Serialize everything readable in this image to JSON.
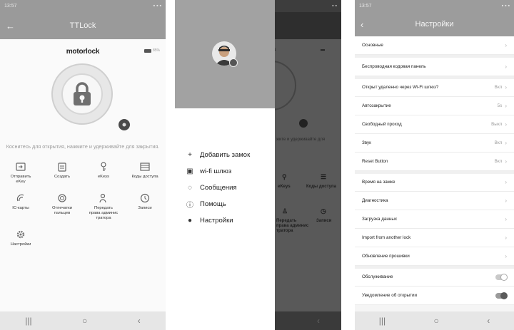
{
  "panel_lock": {
    "status_time": "13:57",
    "status_right": "▪ ▪ ▪",
    "title": "TTLock",
    "brand": "motorlock",
    "battery": "85%",
    "hint": "Коснитесь для открытия, нажмите и удерживайте для закрытия.",
    "grid": [
      {
        "label": "Отправить\neKey",
        "icon": "send-ekey-icon"
      },
      {
        "label": "Создать",
        "icon": "create-icon"
      },
      {
        "label": "eKeys",
        "icon": "ekeys-icon"
      },
      {
        "label": "Коды доступа",
        "icon": "access-codes-icon"
      },
      {
        "label": "IC-карты",
        "icon": "ic-card-icon"
      },
      {
        "label": "Отпечатки\nпальцев",
        "icon": "fingerprint-icon"
      },
      {
        "label": "Передать\nправа админис\nтратора",
        "icon": "transfer-admin-icon"
      },
      {
        "label": "Записи",
        "icon": "records-icon"
      },
      {
        "label": "Настройки",
        "icon": "settings-icon"
      }
    ],
    "nav": [
      "|||",
      "○",
      "‹"
    ]
  },
  "panel_menu": {
    "items": [
      {
        "label": "Добавить замок",
        "icon": "plus-icon"
      },
      {
        "label": "wi-fi шлюз",
        "icon": "gateway-icon"
      },
      {
        "label": "Сообщения",
        "icon": "message-icon"
      },
      {
        "label": "Помощь",
        "icon": "help-icon"
      },
      {
        "label": "Настройки",
        "icon": "settings-icon"
      }
    ],
    "nav": [
      "‹"
    ]
  },
  "panel_settings": {
    "status_time": "13:57",
    "status_right": "▪ ▪ ▪",
    "title": "Настройки",
    "groups": [
      [
        {
          "label": "Основные",
          "value": "",
          "control": "chevron"
        }
      ],
      [
        {
          "label": "Беспроводная кодовая панель",
          "value": "",
          "control": "chevron"
        }
      ],
      [
        {
          "label": "Открыт удаленно через Wi-Fi шлюз?",
          "value": "Вкл",
          "control": "chevron"
        },
        {
          "label": "Автозакрытие",
          "value": "5s",
          "control": "chevron"
        },
        {
          "label": "Свободный проход",
          "value": "Выкл",
          "control": "chevron"
        },
        {
          "label": "Звук",
          "value": "Вкл",
          "control": "chevron"
        },
        {
          "label": "Reset Button",
          "value": "Вкл",
          "control": "chevron"
        }
      ],
      [
        {
          "label": "Время на замке",
          "value": "",
          "control": "chevron"
        },
        {
          "label": "Диагностика",
          "value": "",
          "control": "chevron"
        },
        {
          "label": "Загрузка данных",
          "value": "",
          "control": "chevron"
        },
        {
          "label": "Import from another lock",
          "value": "",
          "control": "chevron"
        },
        {
          "label": "Обновление прошивки",
          "value": "",
          "control": "chevron"
        }
      ],
      [
        {
          "label": "Обслуживание",
          "value": "",
          "control": "toggle-off"
        },
        {
          "label": "Уведомление об открытии",
          "value": "",
          "control": "toggle-on"
        }
      ]
    ],
    "nav": [
      "|||",
      "○",
      "‹"
    ]
  }
}
